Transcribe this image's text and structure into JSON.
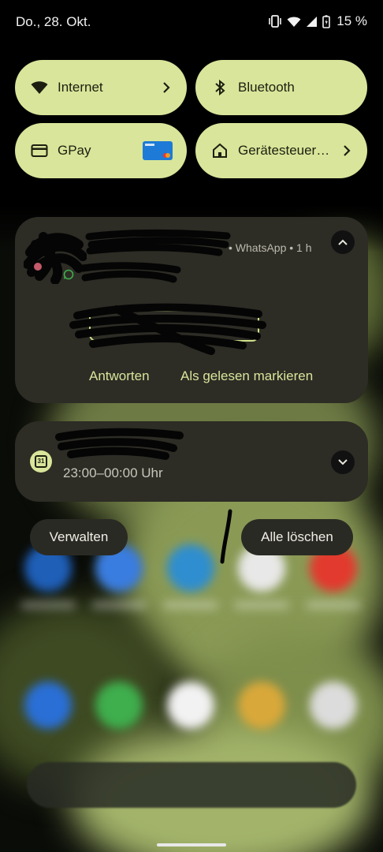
{
  "status_bar": {
    "date": "Do., 28. Okt.",
    "battery": "15 %",
    "icons": [
      "vibrate-icon",
      "wifi-icon",
      "signal-icon",
      "battery-icon"
    ]
  },
  "quick_settings": {
    "tiles": [
      {
        "label": "Internet",
        "icon": "wifi-icon",
        "has_chevron": true
      },
      {
        "label": "Bluetooth",
        "icon": "bluetooth-icon",
        "has_chevron": false
      },
      {
        "label": "GPay",
        "icon": "card-icon",
        "has_card_thumbnail": true
      },
      {
        "label": "Gerätesteuer…",
        "icon": "home-icon",
        "has_chevron": true
      }
    ],
    "accent_color": "#d9e59a"
  },
  "notifications": [
    {
      "app": "WhatsApp",
      "meta": "• WhatsApp • 1 h",
      "expanded": true,
      "actions": [
        "Antworten",
        "Als gelesen markieren"
      ]
    },
    {
      "app": "Calendar",
      "calendar_icon_text": "31",
      "time": "23:00–00:00 Uhr",
      "expanded": false
    }
  ],
  "footer_buttons": {
    "manage": "Verwalten",
    "clear_all": "Alle löschen"
  },
  "colors": {
    "card_background": "#2d2c25",
    "tile_background": "#d9e59a",
    "action_text": "#d9e59a"
  }
}
